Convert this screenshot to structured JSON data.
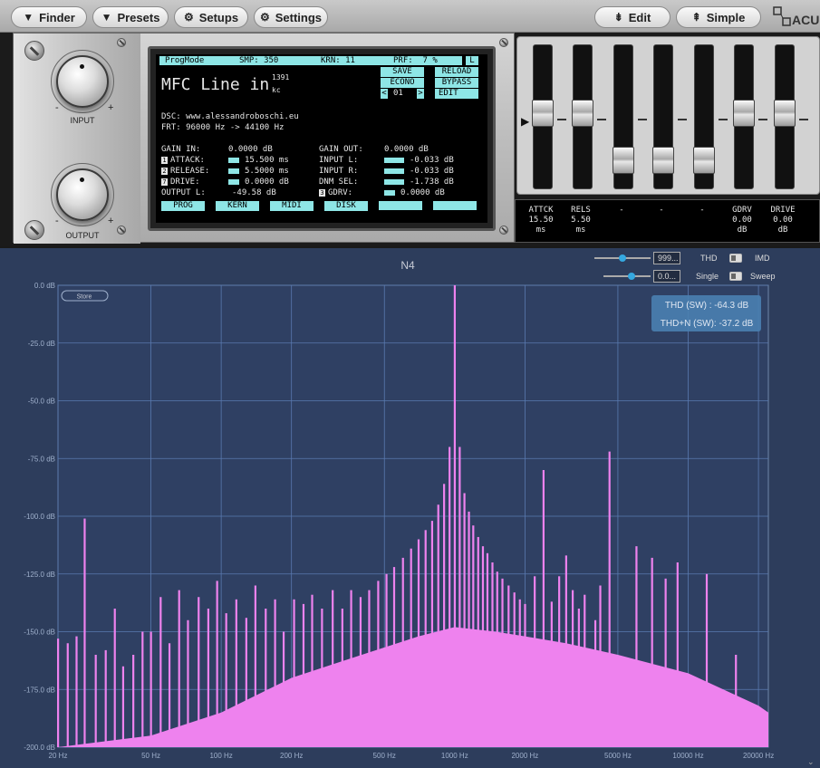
{
  "toolbar": {
    "finder": "Finder",
    "presets": "Presets",
    "setups": "Setups",
    "settings": "Settings",
    "edit": "Edit",
    "simple": "Simple",
    "logo_text": "ACU"
  },
  "knobs": {
    "input_label": "INPUT",
    "output_label": "OUTPUT",
    "minus": "-",
    "plus": "+"
  },
  "lcd": {
    "progmode": "ProgMode",
    "smp": "SMP: 350",
    "krn": "KRN: 11",
    "prf": "PRF:  7 %",
    "l_flag": "L",
    "title": "MFC Line in",
    "title_sup": "1391",
    "title_sub": "kc",
    "save": "SAVE",
    "reload": "RELOAD",
    "econo": "ECONO",
    "bypass": "BYPASS",
    "preset_num": "01",
    "prev_arrow": "<",
    "next_arrow": ">",
    "edit": "EDIT",
    "dsc": "DSC: www.alessandroboschi.eu",
    "frt": "FRT: 96000 Hz -> 44100 Hz",
    "gain_in_label": "GAIN IN:",
    "gain_in_value": "0.0000 dB",
    "attack_idx": "1",
    "attack_label": "ATTACK:",
    "attack_value": "15.500 ms",
    "release_idx": "2",
    "release_label": "RELEASE:",
    "release_value": "5.5000 ms",
    "drive_idx": "7",
    "drive_label": "DRIVE:",
    "drive_value": "0.0000 dB",
    "output_l_label": "OUTPUT L:",
    "output_l_value": "-49.58 dB",
    "gain_out_label": "GAIN OUT:",
    "gain_out_value": "0.0000 dB",
    "input_l_label": "INPUT L:",
    "input_l_value": "-0.033 dB",
    "input_r_label": "INPUT R:",
    "input_r_value": "-0.033 dB",
    "dnm_label": "DNM SEL:",
    "dnm_value": "-1.738 dB",
    "gdrv_idx": "3",
    "gdrv_label": "GDRV:",
    "gdrv_value": "0.0000 dB",
    "tabs": [
      "PROG",
      "KERN",
      "MIDI",
      "DISK",
      "",
      ""
    ]
  },
  "readout": {
    "labels": [
      "ATTCK",
      "RELS",
      "-",
      "-",
      "-",
      "GDRV",
      "DRIVE"
    ],
    "values": [
      "15.50",
      "5.50",
      "",
      "",
      "",
      "0.00",
      "0.00"
    ],
    "units": [
      "ms",
      "ms",
      "",
      "",
      "",
      "dB",
      "dB"
    ]
  },
  "analyzer": {
    "title": "N4",
    "store": "Store",
    "box1": "999...",
    "box2": "0.0...",
    "thd": "THD",
    "imd": "IMD",
    "single": "Single",
    "sweep": "Sweep",
    "thd_result": "THD (SW) : -64.3 dB",
    "thdn_result": "THD+N (SW): -37.2 dB",
    "bg_color": "#2d3d5c",
    "spectrum_color": "#ee82ee"
  },
  "chart_data": {
    "type": "bar",
    "title": "N4",
    "x_scale": "log",
    "xlim": [
      20,
      22050
    ],
    "ylim": [
      -200,
      0
    ],
    "x_ticks": [
      "20 Hz",
      "50 Hz",
      "100 Hz",
      "200 Hz",
      "500 Hz",
      "1000 Hz",
      "2000 Hz",
      "5000 Hz",
      "10000 Hz",
      "20000 Hz"
    ],
    "y_ticks": [
      "0.0 dB",
      "-25.0 dB",
      "-50.0 dB",
      "-75.0 dB",
      "-100.0 dB",
      "-125.0 dB",
      "-150.0 dB",
      "-175.0 dB",
      "-200.0 dB"
    ],
    "fundamental": {
      "freq": 1000,
      "level": 0
    },
    "noise_floor": [
      [
        20,
        -200
      ],
      [
        50,
        -195
      ],
      [
        100,
        -185
      ],
      [
        200,
        -170
      ],
      [
        400,
        -160
      ],
      [
        700,
        -152
      ],
      [
        1000,
        -148
      ],
      [
        1500,
        -150
      ],
      [
        2000,
        -152
      ],
      [
        3000,
        -155
      ],
      [
        5000,
        -160
      ],
      [
        10000,
        -168
      ],
      [
        20000,
        -182
      ],
      [
        22050,
        -185
      ]
    ],
    "spikes": [
      {
        "freq": 20,
        "level": -153
      },
      {
        "freq": 22,
        "level": -155
      },
      {
        "freq": 24,
        "level": -152
      },
      {
        "freq": 26,
        "level": -101
      },
      {
        "freq": 29,
        "level": -160
      },
      {
        "freq": 32,
        "level": -158
      },
      {
        "freq": 35,
        "level": -140
      },
      {
        "freq": 38,
        "level": -165
      },
      {
        "freq": 42,
        "level": -160
      },
      {
        "freq": 46,
        "level": -150
      },
      {
        "freq": 50,
        "level": -150
      },
      {
        "freq": 55,
        "level": -135
      },
      {
        "freq": 60,
        "level": -155
      },
      {
        "freq": 66,
        "level": -132
      },
      {
        "freq": 72,
        "level": -145
      },
      {
        "freq": 80,
        "level": -135
      },
      {
        "freq": 88,
        "level": -140
      },
      {
        "freq": 96,
        "level": -128
      },
      {
        "freq": 105,
        "level": -142
      },
      {
        "freq": 116,
        "level": -136
      },
      {
        "freq": 128,
        "level": -144
      },
      {
        "freq": 140,
        "level": -130
      },
      {
        "freq": 155,
        "level": -140
      },
      {
        "freq": 170,
        "level": -136
      },
      {
        "freq": 185,
        "level": -150
      },
      {
        "freq": 205,
        "level": -136
      },
      {
        "freq": 225,
        "level": -138
      },
      {
        "freq": 245,
        "level": -134
      },
      {
        "freq": 270,
        "level": -140
      },
      {
        "freq": 300,
        "level": -132
      },
      {
        "freq": 330,
        "level": -140
      },
      {
        "freq": 360,
        "level": -132
      },
      {
        "freq": 395,
        "level": -135
      },
      {
        "freq": 430,
        "level": -132
      },
      {
        "freq": 470,
        "level": -128
      },
      {
        "freq": 510,
        "level": -125
      },
      {
        "freq": 550,
        "level": -122
      },
      {
        "freq": 600,
        "level": -118
      },
      {
        "freq": 650,
        "level": -114
      },
      {
        "freq": 700,
        "level": -110
      },
      {
        "freq": 750,
        "level": -106
      },
      {
        "freq": 800,
        "level": -102
      },
      {
        "freq": 850,
        "level": -95
      },
      {
        "freq": 900,
        "level": -86
      },
      {
        "freq": 950,
        "level": -70
      },
      {
        "freq": 1000,
        "level": 0
      },
      {
        "freq": 1050,
        "level": -70
      },
      {
        "freq": 1100,
        "level": -90
      },
      {
        "freq": 1150,
        "level": -98
      },
      {
        "freq": 1200,
        "level": -104
      },
      {
        "freq": 1260,
        "level": -109
      },
      {
        "freq": 1320,
        "level": -113
      },
      {
        "freq": 1380,
        "level": -116
      },
      {
        "freq": 1450,
        "level": -120
      },
      {
        "freq": 1520,
        "level": -124
      },
      {
        "freq": 1600,
        "level": -127
      },
      {
        "freq": 1700,
        "level": -130
      },
      {
        "freq": 1800,
        "level": -133
      },
      {
        "freq": 1900,
        "level": -136
      },
      {
        "freq": 2000,
        "level": -138
      },
      {
        "freq": 2200,
        "level": -126
      },
      {
        "freq": 2400,
        "level": -80
      },
      {
        "freq": 2600,
        "level": -137
      },
      {
        "freq": 2800,
        "level": -126
      },
      {
        "freq": 3000,
        "level": -117
      },
      {
        "freq": 3200,
        "level": -132
      },
      {
        "freq": 3400,
        "level": -140
      },
      {
        "freq": 3600,
        "level": -134
      },
      {
        "freq": 4000,
        "level": -145
      },
      {
        "freq": 4200,
        "level": -130
      },
      {
        "freq": 4600,
        "level": -72
      },
      {
        "freq": 6000,
        "level": -113
      },
      {
        "freq": 7000,
        "level": -118
      },
      {
        "freq": 8000,
        "level": -127
      },
      {
        "freq": 9000,
        "level": -120
      },
      {
        "freq": 12000,
        "level": -125
      },
      {
        "freq": 16000,
        "level": -160
      }
    ]
  }
}
